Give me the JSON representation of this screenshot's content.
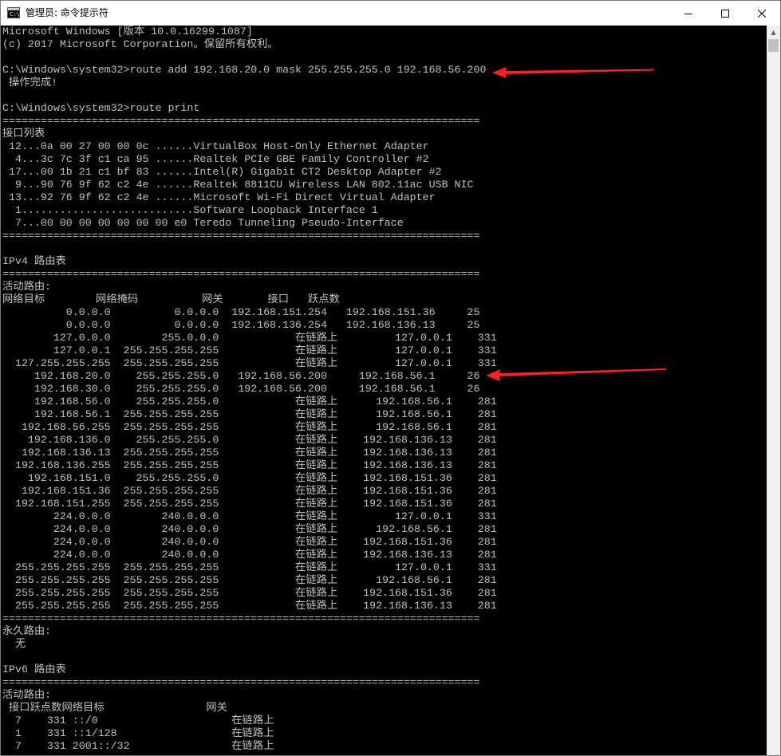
{
  "window": {
    "title": "管理员: 命令提示符",
    "app_icon_text": "C:\\",
    "controls": {
      "minimize": "—",
      "maximize": "☐",
      "close": "✕"
    }
  },
  "console": {
    "text_color": "#c0c0c0",
    "background": "#000000",
    "lines": [
      "Microsoft Windows [版本 10.0.16299.1087]",
      "(c) 2017 Microsoft Corporation。保留所有权利。",
      "",
      "C:\\Windows\\system32>route add 192.168.20.0 mask 255.255.255.0 192.168.56.200",
      " 操作完成!",
      "",
      "C:\\Windows\\system32>route print",
      "===========================================================================",
      "接口列表",
      " 12...0a 00 27 00 00 0c ......VirtualBox Host-Only Ethernet Adapter",
      "  4...3c 7c 3f c1 ca 95 ......Realtek PCIe GBE Family Controller #2",
      " 17...00 1b 21 c1 bf 83 ......Intel(R) Gigabit CT2 Desktop Adapter #2",
      "  9...90 76 9f 62 c2 4e ......Realtek 8811CU Wireless LAN 802.11ac USB NIC",
      " 13...92 76 9f 62 c2 4e ......Microsoft Wi-Fi Direct Virtual Adapter",
      "  1...........................Software Loopback Interface 1",
      "  7...00 00 00 00 00 00 00 e0 Teredo Tunneling Pseudo-Interface",
      "===========================================================================",
      "",
      "IPv4 路由表",
      "===========================================================================",
      "活动路由:",
      "网络目标        网络掩码          网关       接口   跃点数",
      "          0.0.0.0          0.0.0.0  192.168.151.254   192.168.151.36     25",
      "          0.0.0.0          0.0.0.0  192.168.136.254   192.168.136.13     25",
      "        127.0.0.0        255.0.0.0            在链路上         127.0.0.1    331",
      "        127.0.0.1  255.255.255.255            在链路上         127.0.0.1    331",
      "  127.255.255.255  255.255.255.255            在链路上         127.0.0.1    331",
      "     192.168.20.0    255.255.255.0   192.168.56.200     192.168.56.1     26",
      "     192.168.30.0    255.255.255.0   192.168.56.200     192.168.56.1     26",
      "     192.168.56.0    255.255.255.0            在链路上      192.168.56.1    281",
      "     192.168.56.1  255.255.255.255            在链路上      192.168.56.1    281",
      "   192.168.56.255  255.255.255.255            在链路上      192.168.56.1    281",
      "    192.168.136.0    255.255.255.0            在链路上    192.168.136.13    281",
      "   192.168.136.13  255.255.255.255            在链路上    192.168.136.13    281",
      "  192.168.136.255  255.255.255.255            在链路上    192.168.136.13    281",
      "    192.168.151.0    255.255.255.0            在链路上    192.168.151.36    281",
      "   192.168.151.36  255.255.255.255            在链路上    192.168.151.36    281",
      "  192.168.151.255  255.255.255.255            在链路上    192.168.151.36    281",
      "        224.0.0.0        240.0.0.0            在链路上         127.0.0.1    331",
      "        224.0.0.0        240.0.0.0            在链路上      192.168.56.1    281",
      "        224.0.0.0        240.0.0.0            在链路上    192.168.151.36    281",
      "        224.0.0.0        240.0.0.0            在链路上    192.168.136.13    281",
      "  255.255.255.255  255.255.255.255            在链路上         127.0.0.1    331",
      "  255.255.255.255  255.255.255.255            在链路上      192.168.56.1    281",
      "  255.255.255.255  255.255.255.255            在链路上    192.168.151.36    281",
      "  255.255.255.255  255.255.255.255            在链路上    192.168.136.13    281",
      "===========================================================================",
      "永久路由:",
      "  无",
      "",
      "IPv6 路由表",
      "===========================================================================",
      "活动路由:",
      " 接口跃点数网络目标                网关",
      "  7    331 ::/0                     在链路上",
      "  1    331 ::1/128                  在链路上",
      "  7    331 2001::/32                在链路上"
    ]
  },
  "annotations": {
    "arrow_color": "#ff2020"
  }
}
